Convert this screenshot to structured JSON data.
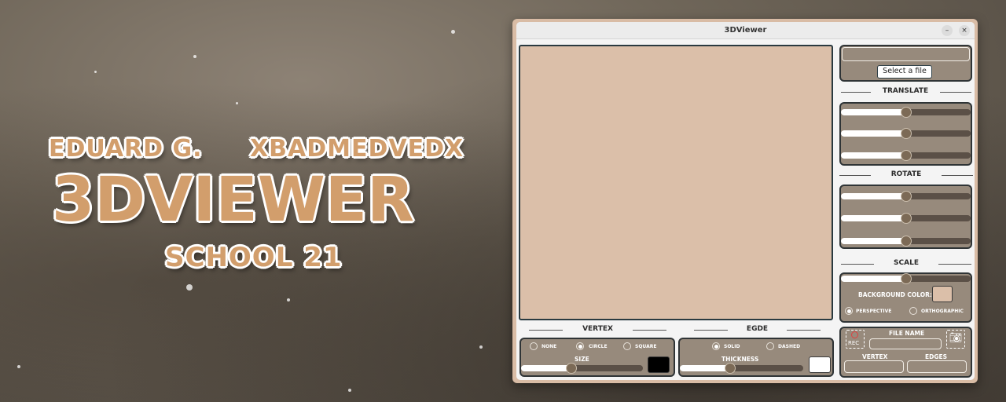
{
  "banner": {
    "author1": "EDUARD G.",
    "author2": "XBADMEDVEDX",
    "title": "3DVIEWER",
    "subtitle": "SCHOOL 21"
  },
  "window": {
    "title": "3DViewer",
    "minimize_label": "–",
    "close_label": "×"
  },
  "file": {
    "path_value": "",
    "select_label": "Select a file"
  },
  "translate": {
    "label": "TRANSLATE",
    "values": [
      50,
      50,
      50
    ]
  },
  "rotate": {
    "label": "ROTATE",
    "values": [
      50,
      50,
      50
    ]
  },
  "scale": {
    "label": "SCALE",
    "value": 50,
    "bg_color_label": "BACKGROUND COLOR:",
    "bg_color": "#dbbfa9",
    "projection": {
      "options": [
        "PERSPECTIVE",
        "ORTHOGRAPHIC"
      ],
      "selected": "PERSPECTIVE"
    }
  },
  "record": {
    "rec_label": "REC",
    "file_name_label": "FILE NAME",
    "vertex_label": "VERTEX",
    "edges_label": "EDGES",
    "file_name_value": "",
    "vertex_value": "",
    "edges_value": ""
  },
  "vertex": {
    "label": "VERTEX",
    "options": [
      "NONE",
      "CIRCLE",
      "SQUARE"
    ],
    "selected": "CIRCLE",
    "size_label": "SIZE",
    "size_value": 41,
    "color": "#000000"
  },
  "edge": {
    "label": "EGDE",
    "options": [
      "SOLID",
      "DASHED"
    ],
    "selected": "SOLID",
    "thickness_label": "THICKNESS",
    "thickness_value": 41,
    "color": "#ffffff"
  },
  "colors": {
    "accent": "#d29e6c",
    "panel": "#978a7c",
    "viewport": "#dbbfa9"
  }
}
